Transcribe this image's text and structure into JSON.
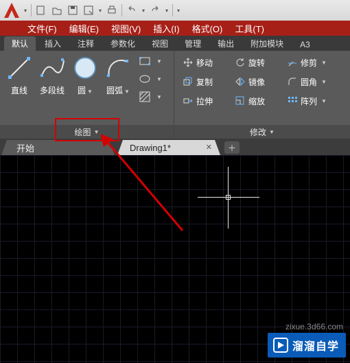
{
  "menubar": {
    "items": [
      "文件(F)",
      "编辑(E)",
      "视图(V)",
      "插入(I)",
      "格式(O)",
      "工具(T)"
    ]
  },
  "ribbon_tabs": {
    "items": [
      "默认",
      "插入",
      "注释",
      "参数化",
      "视图",
      "管理",
      "输出",
      "附加模块",
      "A3"
    ],
    "active_index": 0
  },
  "draw_panel": {
    "title": "绘图",
    "line": "直线",
    "polyline": "多段线",
    "circle": "圆",
    "arc": "圆弧"
  },
  "modify_panel": {
    "title": "修改",
    "move": "移动",
    "rotate": "旋转",
    "trim": "修剪",
    "copy": "复制",
    "mirror": "镜像",
    "fillet": "圆角",
    "stretch": "拉伸",
    "scale": "缩放",
    "array": "阵列"
  },
  "doctabs": {
    "start": "开始",
    "active": "Drawing1*"
  },
  "watermark": {
    "brand": "溜溜自学",
    "url": "zixue.3d66.com"
  }
}
